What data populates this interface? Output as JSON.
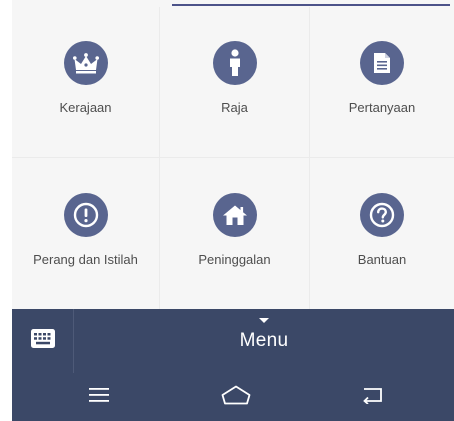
{
  "grid": {
    "items": [
      {
        "label": "Kerajaan",
        "icon": "crown-icon"
      },
      {
        "label": "Raja",
        "icon": "person-info-icon"
      },
      {
        "label": "Pertanyaan",
        "icon": "document-icon"
      },
      {
        "label": "Perang dan Istilah",
        "icon": "exclamation-icon"
      },
      {
        "label": "Peninggalan",
        "icon": "house-icon"
      },
      {
        "label": "Bantuan",
        "icon": "question-icon"
      }
    ]
  },
  "menu_bar": {
    "label": "Menu",
    "keyboard_icon": "keyboard-icon",
    "caret_icon": "caret-down-icon"
  },
  "nav_bar": {
    "icons": [
      "menu-lines-icon",
      "home-icon",
      "back-icon"
    ]
  },
  "colors": {
    "icon_circle": "#59658f",
    "bar_background": "#3b4867",
    "grid_background": "#f6f6f6",
    "label_text": "#4e4e4e"
  }
}
